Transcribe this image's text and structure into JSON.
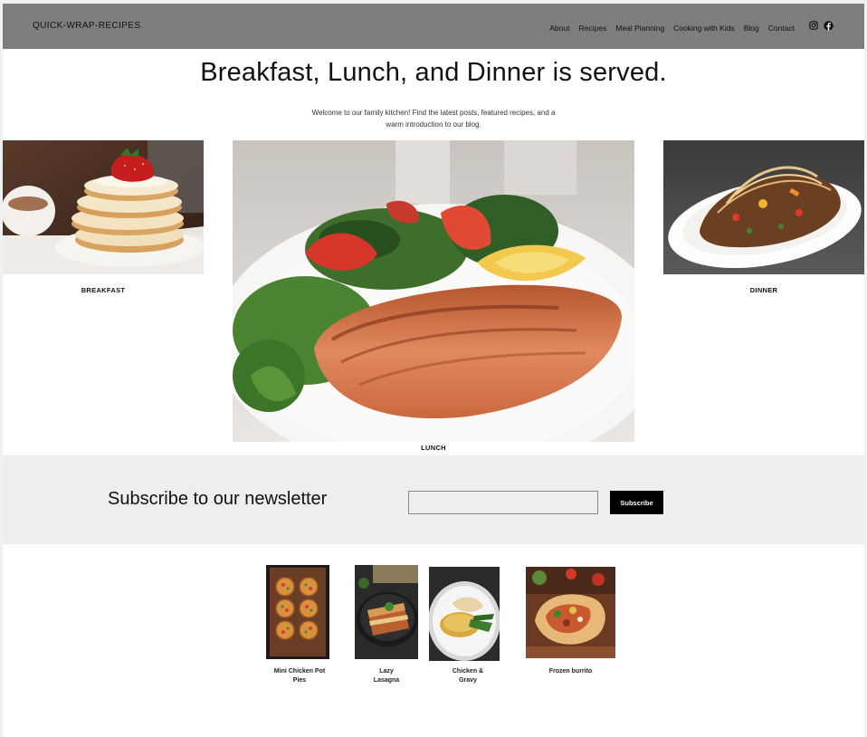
{
  "header": {
    "site_title": "QUICK-WRAP-RECIPES",
    "nav": [
      "About",
      "Recipes",
      "Meal Planning",
      "Cooking with Kids",
      "Blog",
      "Contact"
    ],
    "social_icons": [
      "instagram-icon",
      "facebook-icon"
    ]
  },
  "hero": {
    "title": "Breakfast, Lunch, and Dinner is served.",
    "subtitle_line1": "Welcome to our family kitchen! Find the latest posts, featured recipes, and a",
    "subtitle_line2": "warm introduction to our blog."
  },
  "meals": [
    {
      "label": "BREAKFAST"
    },
    {
      "label": "LUNCH"
    },
    {
      "label": "DINNER"
    }
  ],
  "newsletter": {
    "title": "Subscribe to our newsletter",
    "input_value": "",
    "button_label": "Subscribe"
  },
  "recipes": [
    {
      "line1": "Mini Chicken Pot",
      "line2": "Pies"
    },
    {
      "line1": "Lazy",
      "line2": "Lasagna"
    },
    {
      "line1": "Chicken &",
      "line2": "Gravy"
    },
    {
      "line1": "Frozen burrito",
      "line2": ""
    }
  ]
}
